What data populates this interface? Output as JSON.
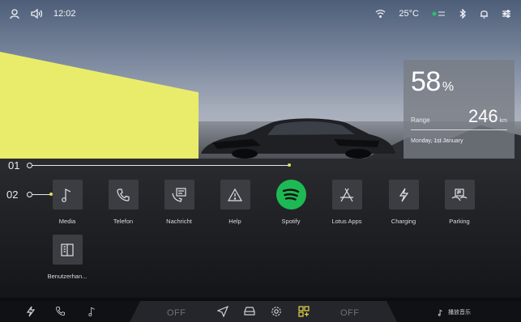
{
  "status_bar": {
    "time": "12:02",
    "temperature": "25°C",
    "icons": [
      "user-icon",
      "volume-icon",
      "wifi-icon",
      "eco-badge-icon",
      "bluetooth-icon",
      "bell-icon",
      "settings-sliders-icon"
    ]
  },
  "battery": {
    "percent": "58",
    "percent_unit": "%",
    "range_label": "Range",
    "range_value": "246",
    "range_unit": "km",
    "date": "Monday, 1st January"
  },
  "callouts": {
    "first": "01",
    "second": "02"
  },
  "apps": [
    {
      "label": "Media",
      "icon": "music-note-icon"
    },
    {
      "label": "Telefon",
      "icon": "phone-icon"
    },
    {
      "label": "Nachricht",
      "icon": "message-icon"
    },
    {
      "label": "Help",
      "icon": "warning-triangle-icon"
    },
    {
      "label": "Spotify",
      "icon": "spotify-icon"
    },
    {
      "label": "Lotus Apps",
      "icon": "app-store-icon"
    },
    {
      "label": "Charging",
      "icon": "lightning-icon"
    },
    {
      "label": "Parking",
      "icon": "parking-icon"
    },
    {
      "label": "Benutzerhan...",
      "icon": "manual-book-icon"
    }
  ],
  "dock": {
    "left_climate": "OFF",
    "right_climate": "OFF",
    "music_text": "播放音乐",
    "icons": [
      "lightning-icon",
      "phone-icon",
      "music-note-icon",
      "navigation-icon",
      "car-icon",
      "gear-icon",
      "apps-grid-icon"
    ],
    "accent_color": "#e6d54a"
  }
}
